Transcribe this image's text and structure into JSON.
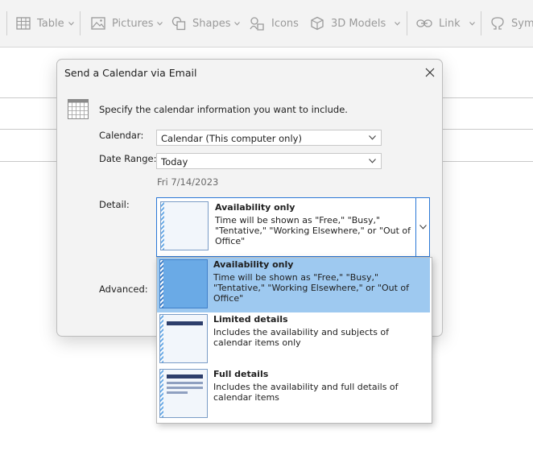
{
  "ribbon": {
    "items": [
      {
        "label": "Table",
        "icon": "table-icon"
      },
      {
        "label": "Pictures",
        "icon": "pictures-icon"
      },
      {
        "label": "Shapes",
        "icon": "shapes-icon"
      },
      {
        "label": "Icons",
        "icon": "icons-icon"
      },
      {
        "label": "3D Models",
        "icon": "3d-models-icon"
      },
      {
        "label": "Link",
        "icon": "link-icon"
      },
      {
        "label": "Symb",
        "icon": "symbol-icon"
      }
    ]
  },
  "dialog": {
    "title": "Send a Calendar via Email",
    "instruction": "Specify the calendar information you want to include.",
    "calendar_label": "Calendar:",
    "calendar_value": "Calendar (This computer only)",
    "date_range_label": "Date Range:",
    "date_range_value": "Today",
    "date_text": "Fri 7/14/2023",
    "detail_label": "Detail:",
    "advanced_label": "Advanced:",
    "detail_selected": {
      "title": "Availability only",
      "description": "Time will be shown as \"Free,\" \"Busy,\" \"Tentative,\" \"Working Elsewhere,\" or \"Out of Office\""
    },
    "detail_options": [
      {
        "title": "Availability only",
        "description": "Time will be shown as \"Free,\" \"Busy,\" \"Tentative,\" \"Working Elsewhere,\" or \"Out of Office\"",
        "selected": true
      },
      {
        "title": "Limited details",
        "description": "Includes the availability and subjects of calendar items only",
        "selected": false
      },
      {
        "title": "Full details",
        "description": "Includes the availability and full details of calendar items",
        "selected": false
      }
    ]
  },
  "colors": {
    "accent": "#2b78d6",
    "selected_bg": "#9ec9f0",
    "thumb_blue": "#6aaae6",
    "thumb_dark": "#2d3e6b"
  }
}
